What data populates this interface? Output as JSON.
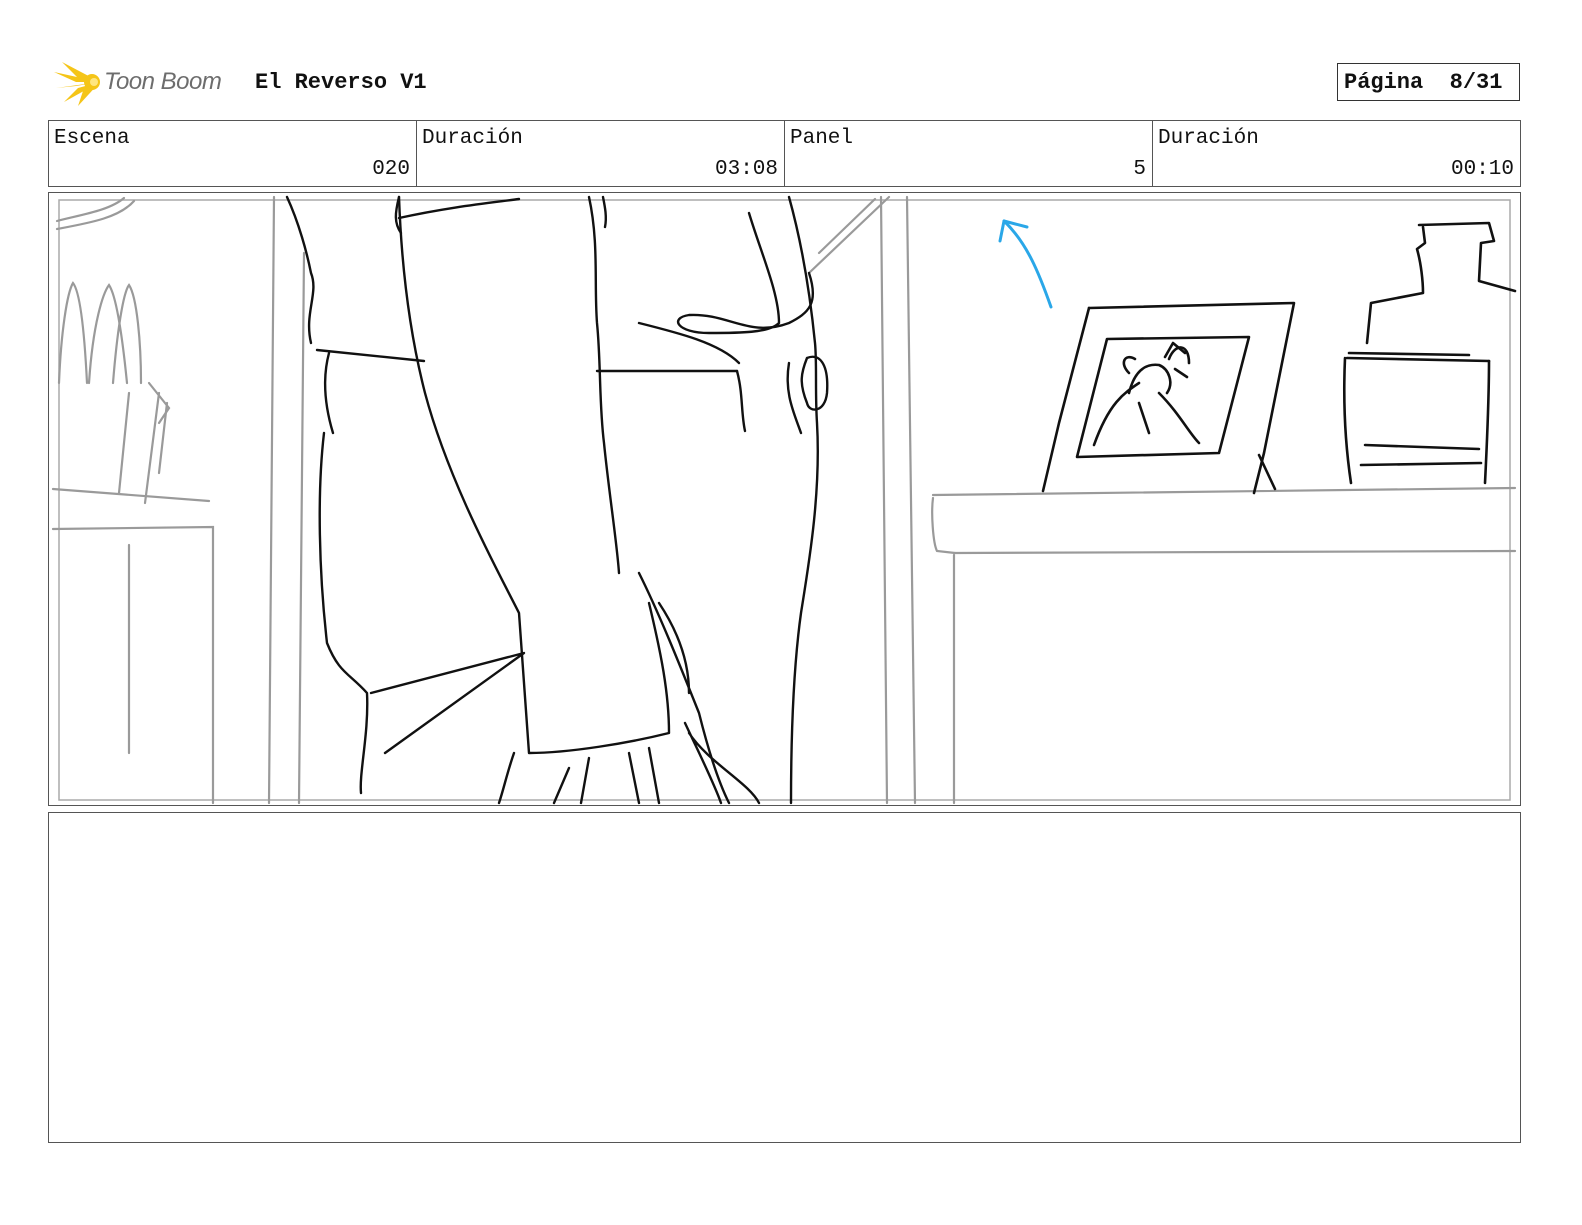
{
  "header": {
    "logo_text": "Toon Boom",
    "project_title": "El Reverso V1",
    "page_label": "Página",
    "page_number": "8/31"
  },
  "info": {
    "scene_label": "Escena",
    "scene_value": "020",
    "scene_duration_label": "Duración",
    "scene_duration_value": "03:08",
    "panel_label": "Panel",
    "panel_value": "5",
    "panel_duration_label": "Duración",
    "panel_duration_value": "00:10"
  },
  "colors": {
    "logo_yellow": "#f5c518",
    "arrow_blue": "#2aa7e8",
    "sketch_gray": "#9a9a9a"
  }
}
